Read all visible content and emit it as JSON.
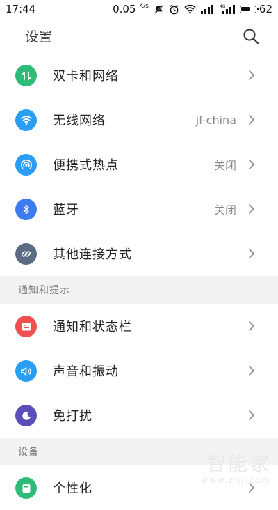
{
  "status_bar": {
    "time": "17:44",
    "net_speed": "0.05",
    "net_speed_unit": "K/s",
    "battery_percent": "62",
    "battery_level": 0.62,
    "icons": [
      "mute-icon",
      "alarm-icon",
      "wifi-icon",
      "signal-icon",
      "signal-4g-icon",
      "battery-icon"
    ]
  },
  "header": {
    "title": "设置",
    "search_icon": "search-icon"
  },
  "groups": [
    {
      "items": [
        {
          "label": "双卡和网络",
          "value": "",
          "icon": "dual-sim-icon",
          "color": "#2ebc78"
        },
        {
          "label": "无线网络",
          "value": "jf-china",
          "icon": "wifi-icon",
          "color": "#2a9df4"
        },
        {
          "label": "便携式热点",
          "value": "关闭",
          "icon": "hotspot-icon",
          "color": "#2a9df4"
        },
        {
          "label": "蓝牙",
          "value": "关闭",
          "icon": "bluetooth-icon",
          "color": "#3d7cf0"
        },
        {
          "label": "其他连接方式",
          "value": "",
          "icon": "link-icon",
          "color": "#5a6b82"
        }
      ]
    },
    {
      "title": "通知和提示",
      "items": [
        {
          "label": "通知和状态栏",
          "value": "",
          "icon": "notification-icon",
          "color": "#f05050"
        },
        {
          "label": "声音和振动",
          "value": "",
          "icon": "sound-icon",
          "color": "#2a9df4"
        },
        {
          "label": "免打扰",
          "value": "",
          "icon": "moon-icon",
          "color": "#5a4fb8"
        }
      ]
    },
    {
      "title": "设备",
      "items": [
        {
          "label": "个性化",
          "value": "",
          "icon": "personalize-icon",
          "color": "#2ebc78"
        }
      ]
    }
  ],
  "watermark": {
    "text": "智能家",
    "url": "www.znj.com"
  }
}
